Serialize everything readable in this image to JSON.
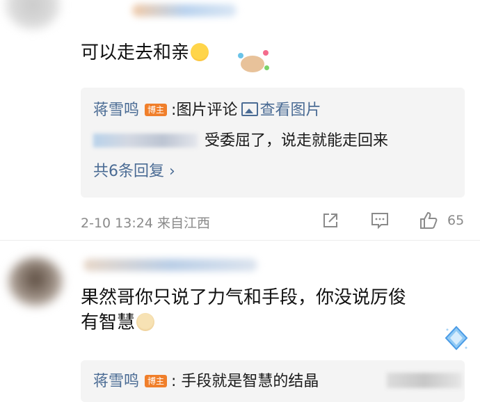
{
  "comments": [
    {
      "text": "可以走去和亲",
      "reply": {
        "author": "蒋雪鸣",
        "badge": "博主",
        "text": ":图片评论",
        "link": "查看图片"
      },
      "sub_reply_text": "受委屈了，说走就能走回来",
      "more_replies": "共6条回复 ›",
      "time": "2-10 13:24",
      "location": "来自江西",
      "likes": "65"
    },
    {
      "text_line1": "果然哥你只说了力气和手段，你没说厉俊",
      "text_line2": "有智慧",
      "reply": {
        "author": "蒋雪鸣",
        "badge": "博主",
        "text": ": 手段就是智慧的结晶"
      }
    }
  ],
  "icons": {
    "share": "share-icon",
    "comment": "comment-icon",
    "like": "thumb-up-icon",
    "picture": "picture-icon"
  },
  "colors": {
    "author": "#4a6b94",
    "badge": "#f07f2b",
    "meta": "#8a8a8a",
    "reply_bg": "#f4f4f4"
  }
}
